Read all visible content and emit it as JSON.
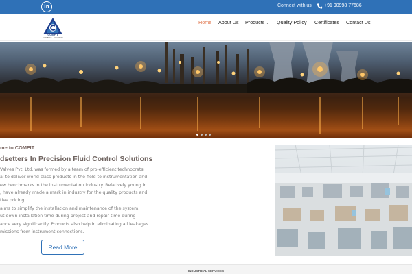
{
  "topbar": {
    "linkedin_label": "in",
    "connect_text": "Connect with us",
    "phone": "+91 90998 77686"
  },
  "header": {
    "logo_text": "COMFIT",
    "logo_tagline": "FOR BEST ...SOLUTION",
    "nav": [
      {
        "label": "Home",
        "active": true
      },
      {
        "label": "About Us"
      },
      {
        "label": "Products",
        "has_dropdown": true
      },
      {
        "label": "Quality Policy"
      },
      {
        "label": "Certificates"
      },
      {
        "label": "Contact Us"
      }
    ]
  },
  "hero": {
    "slides": 4,
    "active_slide": 1
  },
  "content": {
    "welcome": "me to COMFIT",
    "headline": "dsetters In Precision Fluid Control Solutions",
    "paragraph1": [
      "Valves Pvt. Ltd. was formed by a team of pro-efficient technocrats",
      "al to deliver world class products in the field to instrumentation and to",
      "ew benchmarks in the instrumentation industry. Relatively young in the",
      ", have already made a mark in industry for the quality products and",
      "tive pricing."
    ],
    "paragraph2": [
      "aims to simplify the installation and maintenance of the system,",
      "ut down installation time during project and repair time during",
      "ance very significantly. Products also help in eliminating all leakages /",
      "missions from instrument connections."
    ],
    "read_more": "Read More"
  },
  "footer_strip": {
    "label": "INDUSTRIAL SERVICES"
  },
  "colors": {
    "brand_blue": "#2f71b7",
    "nav_active": "#e0744a"
  }
}
